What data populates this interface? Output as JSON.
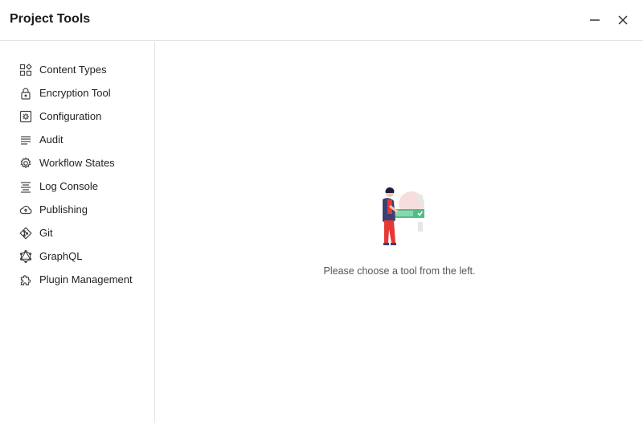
{
  "header": {
    "title": "Project Tools"
  },
  "sidebar": {
    "items": [
      {
        "label": "Content Types",
        "icon": "widgets-icon"
      },
      {
        "label": "Encryption Tool",
        "icon": "lock-icon"
      },
      {
        "label": "Configuration",
        "icon": "settings-square-icon"
      },
      {
        "label": "Audit",
        "icon": "lines-icon"
      },
      {
        "label": "Workflow States",
        "icon": "gear-icon"
      },
      {
        "label": "Log Console",
        "icon": "align-center-icon"
      },
      {
        "label": "Publishing",
        "icon": "cloud-upload-icon"
      },
      {
        "label": "Git",
        "icon": "git-icon"
      },
      {
        "label": "GraphQL",
        "icon": "graphql-icon"
      },
      {
        "label": "Plugin Management",
        "icon": "puzzle-icon"
      }
    ]
  },
  "main": {
    "empty_message": "Please choose a tool from the left.",
    "illustration": "person-with-checklist-illustration"
  },
  "colors": {
    "accent_green": "#4fbf86",
    "figure_red": "#e53935",
    "figure_navy": "#3b3f73",
    "border": "#e3e3e3"
  }
}
